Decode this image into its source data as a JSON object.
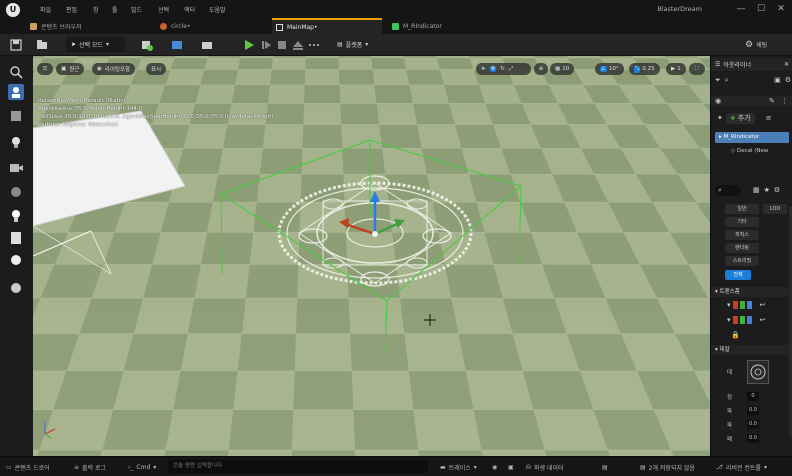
{
  "menu": [
    "파일",
    "편집",
    "창",
    "툴",
    "빌드",
    "선택",
    "액터",
    "도움말"
  ],
  "window_title": "BlasterDream",
  "window_controls": [
    "—",
    "☐",
    "✕"
  ],
  "tabs": [
    {
      "label": "콘텐츠 브라우저",
      "active": false
    },
    {
      "label": "circle•",
      "active": false
    },
    {
      "label": "MainMap•",
      "active": true
    },
    {
      "label": "M_RIndicator",
      "active": false
    }
  ],
  "toolbar": {
    "mode_label": "선택 모드",
    "platform_label": "플랫폼",
    "settings_label": "세팅"
  },
  "viewport": {
    "perspective_label": "원근",
    "lit_label": "라이팅포함",
    "show_label": "표시",
    "grid_snap": "10",
    "rotation_snap": "10°",
    "scale_snap": "0.25",
    "camera_speed": "1",
    "stats": [
      "RecastNavMesh-Default (Static)",
      "AgentRadius 35.0, AgentHeight 144.0",
      "CellSizes 35.0/10.0/10.0/10.0, AgentMaxStepHeight 35.0/35.0/35.0 (low/default/high)",
      "Partition Regions: Watershed",
      "",
      "",
      "",
      ""
    ]
  },
  "outliner": {
    "title": "아웃라이너",
    "add_label": "추가",
    "actor_name": "M_RIndicator",
    "component_name": "Decal (New"
  },
  "details": {
    "categories": [
      "일반",
      "LOD",
      "기타",
      "피직스",
      "렌더링",
      "스트리밍",
      "전체"
    ],
    "transform_label": "트랜스폼",
    "decal_label": "데칼",
    "props": [
      {
        "label": "데",
        "value": ""
      },
      {
        "label": "정",
        "value": "0"
      },
      {
        "label": "파",
        "value": "0.0"
      },
      {
        "label": "파",
        "value": "0.0"
      },
      {
        "label": "페",
        "value": "0.0"
      }
    ]
  },
  "bottombar": {
    "content_drawer": "콘텐츠 드로어",
    "output_log": "출력 로그",
    "cmd": "Cmd",
    "console_placeholder": "콘솔 명령 입력합니다",
    "trace": "트레이스",
    "derived_data": "파생 데이터",
    "unsaved": "2개 저장되지 않음",
    "revision": "리비전 컨트롤"
  },
  "colors": {
    "accent": "#f0a000",
    "select_blue": "#1a7fd8",
    "play_green": "#5cc940",
    "floor_light": "#a6b38c",
    "floor_dark": "#8a9a72",
    "selection_green": "#3ccf3c"
  }
}
